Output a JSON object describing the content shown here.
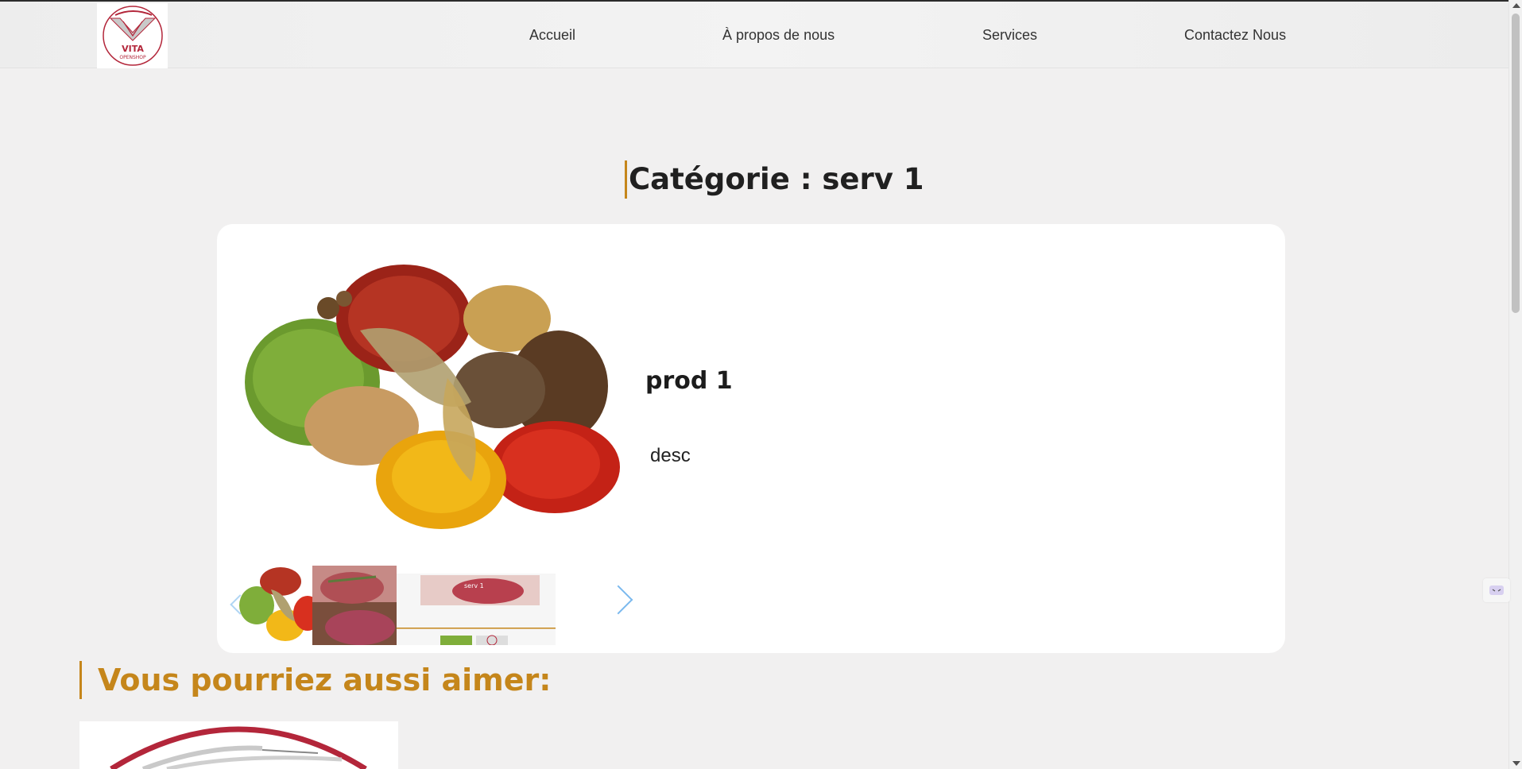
{
  "nav": {
    "logo_text": "VITA",
    "logo_subtext": "OPENSHOP",
    "items": [
      {
        "label": "Accueil"
      },
      {
        "label": "À propos de nous"
      },
      {
        "label": "Services"
      },
      {
        "label": "Contactez Nous"
      }
    ]
  },
  "category": {
    "title": "Catégorie : serv 1"
  },
  "product": {
    "name": "prod 1",
    "description": "desc",
    "thumbnail_label": "serv 1"
  },
  "related": {
    "title": "Vous pourriez aussi aimer:"
  },
  "colors": {
    "accent": "#c5861b",
    "brand_red": "#b3263a",
    "carousel_arrow": "#7ab9ee"
  },
  "icons": {
    "carousel_prev": "chevron-left-icon",
    "carousel_next": "chevron-right-icon",
    "side_widget": "chat-icon"
  }
}
